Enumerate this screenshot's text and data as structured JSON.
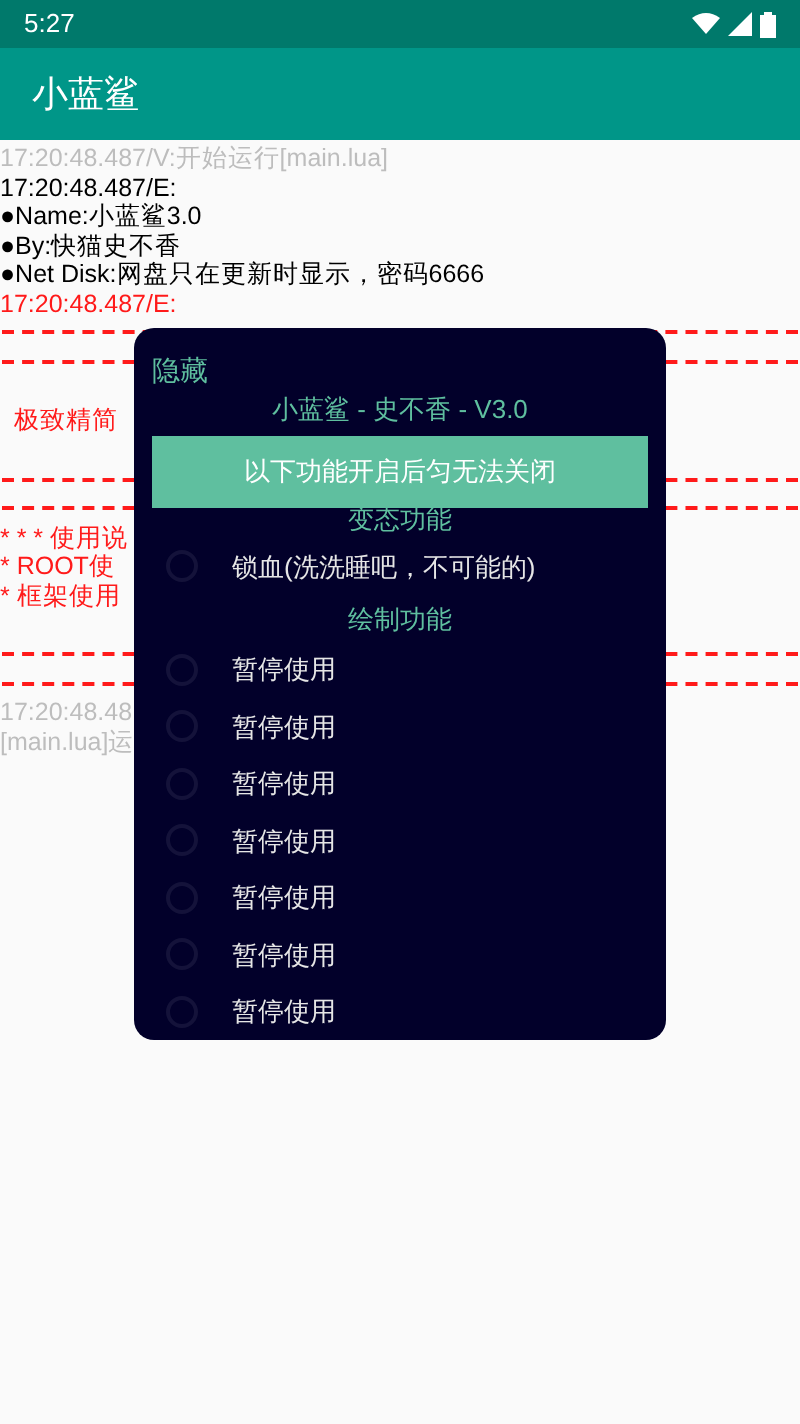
{
  "status_bar": {
    "time": "5:27"
  },
  "app_bar": {
    "title": "小蓝鲨"
  },
  "log": [
    {
      "kind": "verbose",
      "text": "17:20:48.487/V:开始运行[main.lua]"
    },
    {
      "kind": "plain",
      "text": "17:20:48.487/E:"
    },
    {
      "kind": "plain",
      "text": "●Name:小蓝鲨3.0"
    },
    {
      "kind": "plain",
      "text": "●By:快猫史不香"
    },
    {
      "kind": "plain",
      "text": "●Net Disk:网盘只在更新时显示，密码6666"
    },
    {
      "kind": "error",
      "text": "17:20:48.487/E:"
    },
    {
      "kind": "rule"
    },
    {
      "kind": "rule"
    },
    {
      "kind": "gap"
    },
    {
      "kind": "error",
      "text": "  极致精简"
    },
    {
      "kind": "gap"
    },
    {
      "kind": "rule"
    },
    {
      "kind": "rule"
    },
    {
      "kind": "error",
      "text": "* * * 使用说"
    },
    {
      "kind": "error",
      "text": "* ROOT使"
    },
    {
      "kind": "error",
      "text": "* 框架使用"
    },
    {
      "kind": "gap"
    },
    {
      "kind": "rule"
    },
    {
      "kind": "rule"
    },
    {
      "kind": "verbose",
      "text": "17:20:48.48"
    },
    {
      "kind": "verbose",
      "text": "[main.lua]运"
    }
  ],
  "dialog": {
    "hide_label": "隐藏",
    "title": "小蓝鲨 - 史不香 - V3.0",
    "banner": "以下功能开启后匀无法关闭",
    "sections": [
      {
        "heading": "变态功能",
        "options": [
          {
            "label": "锁血(洗洗睡吧，不可能的)",
            "checked": false
          }
        ]
      },
      {
        "heading": "绘制功能",
        "options": [
          {
            "label": "暂停使用",
            "checked": false
          },
          {
            "label": "暂停使用",
            "checked": false
          },
          {
            "label": "暂停使用",
            "checked": false
          },
          {
            "label": "暂停使用",
            "checked": false
          },
          {
            "label": "暂停使用",
            "checked": false
          },
          {
            "label": "暂停使用",
            "checked": false
          },
          {
            "label": "暂停使用",
            "checked": false
          }
        ]
      }
    ]
  }
}
